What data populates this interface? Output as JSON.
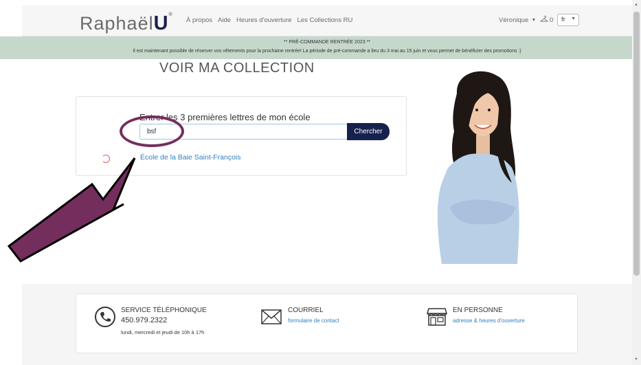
{
  "header": {
    "logo_text": "Raphaël",
    "logo_u": "U",
    "logo_reg": "®",
    "nav": [
      "À propos",
      "Aide",
      "Heures d'ouverture",
      "Les Collections RU"
    ],
    "user": "Véronique",
    "cart_count": "0",
    "lang": "fr"
  },
  "banner": {
    "line1": "** PRÉ-COMMANDE RENTRÉE 2023 **",
    "line2": "Il est maintenant possible de réserver vos vêtements pour la prochaine rentrée! La période de pré-commande a lieu du 3 mai au 15 juin et vous permet de bénéficier des promotions :)"
  },
  "main": {
    "title": "VOIR MA COLLECTION",
    "search_label": "Entrer les 3 premières lettres de mon école",
    "search_value": "bsf",
    "search_button": "Chercher",
    "result": "École de la Baie Saint-François"
  },
  "footer": {
    "phone_title": "SERVICE TÉLÉPHONIQUE",
    "phone_number": "450.979.2322",
    "phone_hours": "lundi, mercredi et jeudi de 10h à 17h",
    "email_title": "COURRIEL",
    "email_link": "formulaire de contact",
    "store_title": "EN PERSONNE",
    "store_link": "adresse & heures d'ouverture"
  },
  "colors": {
    "banner": "#c6d8cc",
    "button": "#16224e",
    "link": "#2f7fbf",
    "annotation": "#742e5d"
  }
}
